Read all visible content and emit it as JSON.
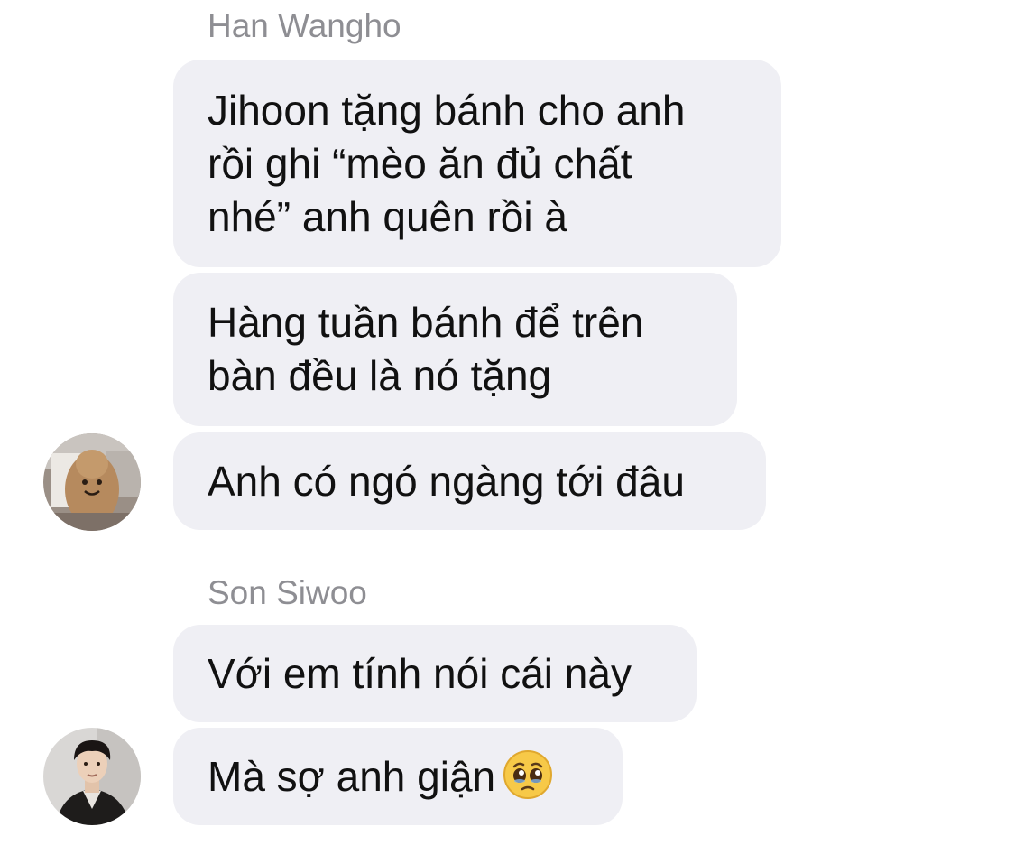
{
  "groups": [
    {
      "sender": "Han Wangho",
      "messages": [
        "Jihoon tặng bánh cho anh\nrồi ghi “mèo ăn đủ chất\nnhé” anh quên rồi à",
        "Hàng tuần bánh để trên\nbàn đều là nó tặng",
        "Anh có ngó ngàng tới đâu"
      ],
      "avatar_icon": "plush-toy-avatar"
    },
    {
      "sender": "Son Siwoo",
      "messages": [
        "Với em tính nói cái này",
        "Mà sợ anh giận"
      ],
      "emoji": "pleading-face-emoji",
      "avatar_icon": "person-photo-avatar"
    }
  ]
}
